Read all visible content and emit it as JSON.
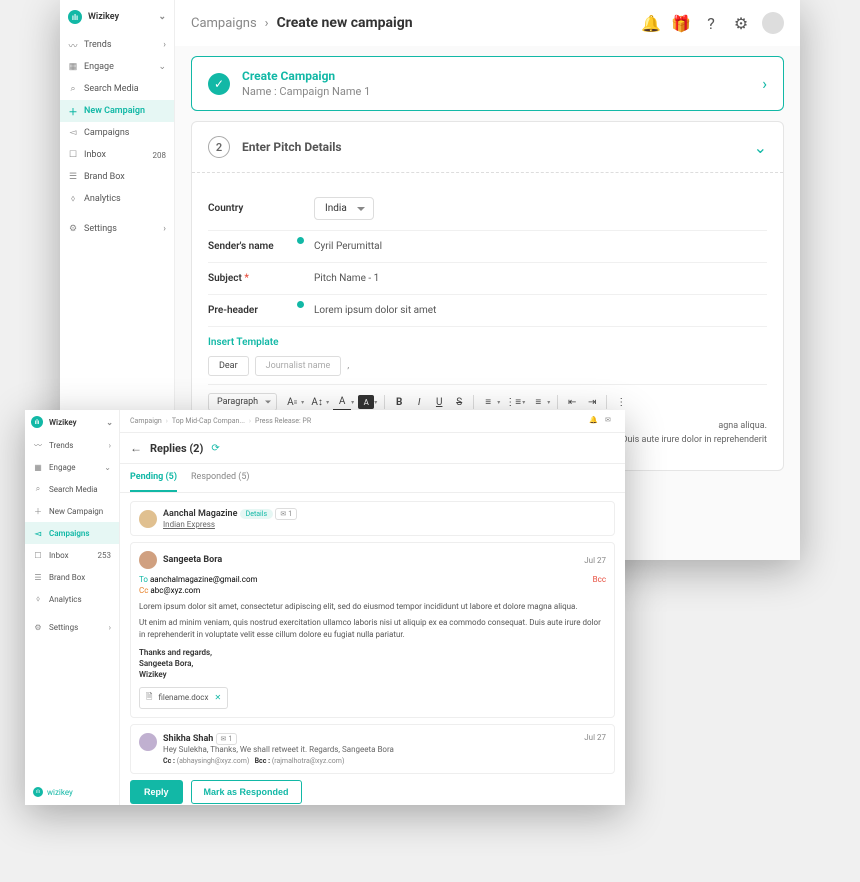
{
  "main_window": {
    "brand": "Wizikey",
    "sidebar": {
      "items": [
        {
          "icon": "trend",
          "label": "Trends",
          "chevron": true
        },
        {
          "icon": "engage",
          "label": "Engage",
          "chevron": true
        },
        {
          "icon": "search",
          "label": "Search Media"
        },
        {
          "icon": "plus",
          "label": "New Campaign",
          "active": true
        },
        {
          "icon": "campaign",
          "label": "Campaigns"
        },
        {
          "icon": "inbox",
          "label": "Inbox",
          "badge": "208"
        },
        {
          "icon": "brand",
          "label": "Brand Box"
        },
        {
          "icon": "analytics",
          "label": "Analytics"
        }
      ],
      "settings_label": "Settings"
    },
    "breadcrumb": {
      "parent": "Campaigns",
      "current": "Create new campaign"
    },
    "step1": {
      "title": "Create Campaign",
      "subtitle": "Name : Campaign Name 1"
    },
    "step2": {
      "number": "2",
      "title": "Enter Pitch Details",
      "country_label": "Country",
      "country_value": "India",
      "sender_label": "Sender's name",
      "sender_value": "Cyril Perumittal",
      "subject_label": "Subject",
      "subject_value": "Pitch Name - 1",
      "preheader_label": "Pre-header",
      "preheader_value": "Lorem ipsum dolor sit amet",
      "insert_template": "Insert Template",
      "pill_dear": "Dear",
      "pill_journalist": "Journalist name",
      "comma": ",",
      "rte_paragraph": "Paragraph",
      "body_line1": "agna aliqua.",
      "body_line2": "Duis aute irure dolor in reprehenderit"
    }
  },
  "overlay": {
    "brand": "Wizikey",
    "sidebar": {
      "items": [
        {
          "icon": "trend",
          "label": "Trends",
          "chevron": true
        },
        {
          "icon": "engage",
          "label": "Engage",
          "chevron": true
        },
        {
          "icon": "search",
          "label": "Search Media"
        },
        {
          "icon": "plus",
          "label": "New Campaign"
        },
        {
          "icon": "campaign",
          "label": "Campaigns",
          "active": true
        },
        {
          "icon": "inbox",
          "label": "Inbox",
          "badge": "253"
        },
        {
          "icon": "brand",
          "label": "Brand Box"
        },
        {
          "icon": "analytics",
          "label": "Analytics"
        }
      ],
      "settings_label": "Settings",
      "footer_brand": "wizikey"
    },
    "breadcrumb": [
      "Campaign",
      "Top Mid-Cap Compan...",
      "Press Release: PR"
    ],
    "replies_title": "Replies (2)",
    "tabs": {
      "pending": "Pending (5)",
      "responded": "Responded (5)"
    },
    "contact": {
      "name": "Aanchal Magazine",
      "org": "Indian Express",
      "details": "Details",
      "count": "1"
    },
    "reply1": {
      "name": "Sangeeta Bora",
      "date": "Jul 27",
      "to_label": "To",
      "to_value": "aanchalmagazine@gmail.com",
      "cc_label": "Cc",
      "cc_value": "abc@xyz.com",
      "bcc_label": "Bcc",
      "body_p1": "Lorem ipsum dolor sit amet, consectetur adipiscing elit, sed do eiusmod tempor incididunt ut labore et dolore magna aliqua.",
      "body_p2": "Ut enim ad minim veniam, quis nostrud exercitation ullamco laboris nisi ut aliquip ex ea commodo consequat. Duis aute irure dolor in reprehenderit in voluptate velit esse cillum dolore eu fugiat nulla pariatur.",
      "sign1": "Thanks and regards,",
      "sign2": "Sangeeta Bora,",
      "sign3": "Wizikey",
      "attachment": "filename.docx"
    },
    "reply2": {
      "name": "Shikha Shah",
      "count": "1",
      "body": "Hey Sulekha, Thanks, We shall retweet it. Regards, Sangeeta Bora",
      "date": "Jul 27",
      "cc_label": "Cc :",
      "cc_value": "(abhaysingh@xyz.com)",
      "bcc_label": "Bcc :",
      "bcc_value": "(rajmalhotra@xyz.com)"
    },
    "actions": {
      "reply": "Reply",
      "mark": "Mark as Responded"
    }
  }
}
